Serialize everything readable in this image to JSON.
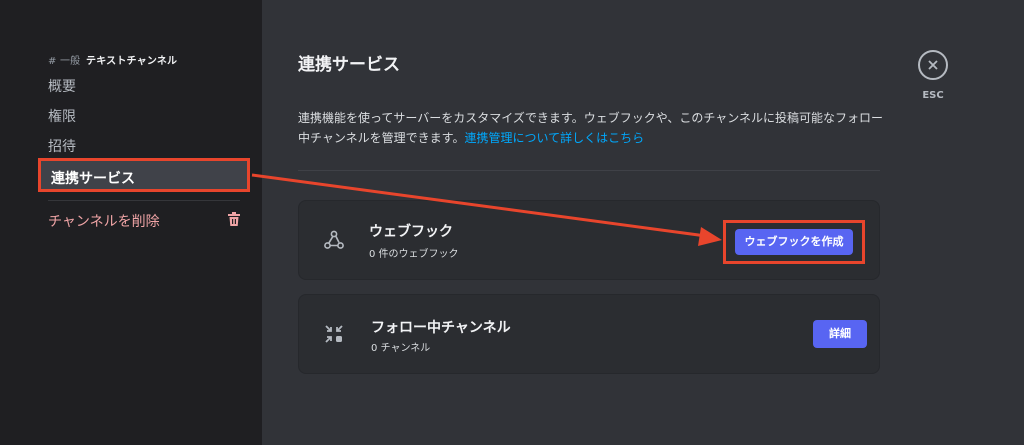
{
  "sidebar": {
    "header_prefix": "# 一般",
    "channel_name": "テキストチャンネル",
    "items": [
      {
        "label": "概要"
      },
      {
        "label": "権限"
      },
      {
        "label": "招待"
      },
      {
        "label": "連携サービス"
      }
    ],
    "delete_label": "チャンネルを削除"
  },
  "main": {
    "title": "連携サービス",
    "description": "連携機能を使ってサーバーをカスタマイズできます。ウェブフックや、このチャンネルに投稿可能なフォロー中チャンネルを管理できます。",
    "link_text": "連携管理について詳しくはこちら",
    "webhooks": {
      "title": "ウェブフック",
      "count_text": "0 件のウェブフック",
      "button_label": "ウェブフックを作成",
      "icon": "webhook-icon"
    },
    "followed": {
      "title": "フォロー中チャンネル",
      "count_text": "0 チャンネル",
      "button_label": "詳細",
      "icon": "follow-channel-icon"
    }
  },
  "close": {
    "label": "ESC",
    "icon": "close-icon"
  },
  "colors": {
    "accent": "#5865f2",
    "highlight": "#e8452c",
    "danger": "#f0a4a6",
    "link": "#00a8fc"
  }
}
